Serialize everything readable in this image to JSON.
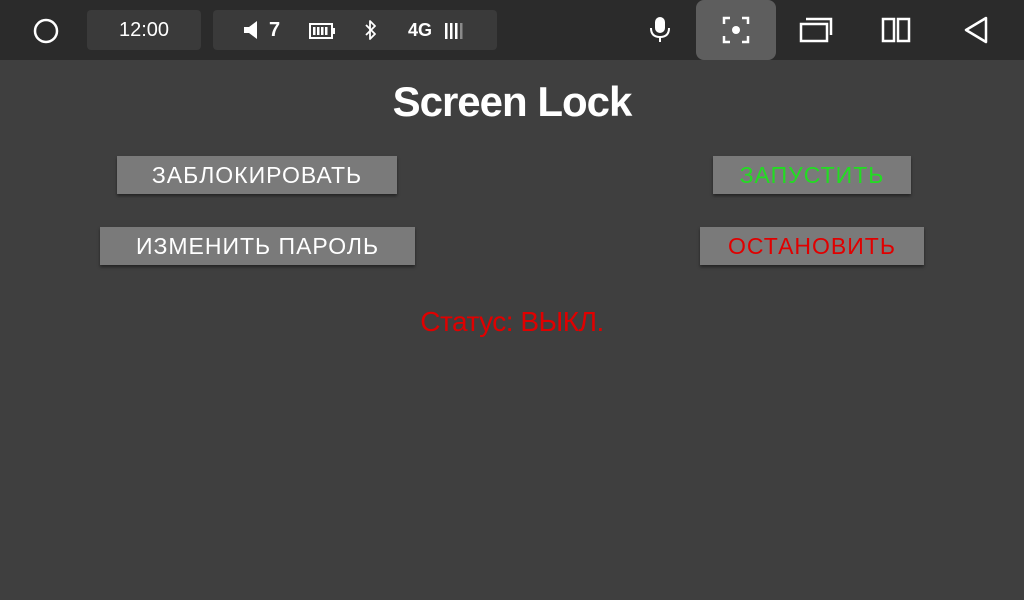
{
  "statusbar": {
    "time": "12:00",
    "volume": "7",
    "network": "4G",
    "icons": {
      "home": "circle-home-icon",
      "volume": "speaker-icon",
      "battery": "battery-icon",
      "bluetooth": "bluetooth-icon",
      "signal": "signal-icon"
    }
  },
  "navbar": {
    "icons": [
      "microphone-icon",
      "screenshot-icon",
      "recent-apps-icon",
      "split-screen-icon",
      "back-icon"
    ],
    "active": "screenshot-icon"
  },
  "app": {
    "title": "Screen Lock",
    "buttons": {
      "lock": "ЗАБЛОКИРОВАТЬ",
      "start": "ЗАПУСТИТЬ",
      "change_password": "ИЗМЕНИТЬ ПАРОЛЬ",
      "stop": "ОСТАНОВИТЬ"
    },
    "status": "Статус: ВЫКЛ."
  },
  "colors": {
    "background": "#3f3f3f",
    "statusbar": "#2b2b2b",
    "button": "#7a7a7a",
    "start_text": "#22dd22",
    "stop_text": "#e00000",
    "status_text": "#e00000"
  }
}
